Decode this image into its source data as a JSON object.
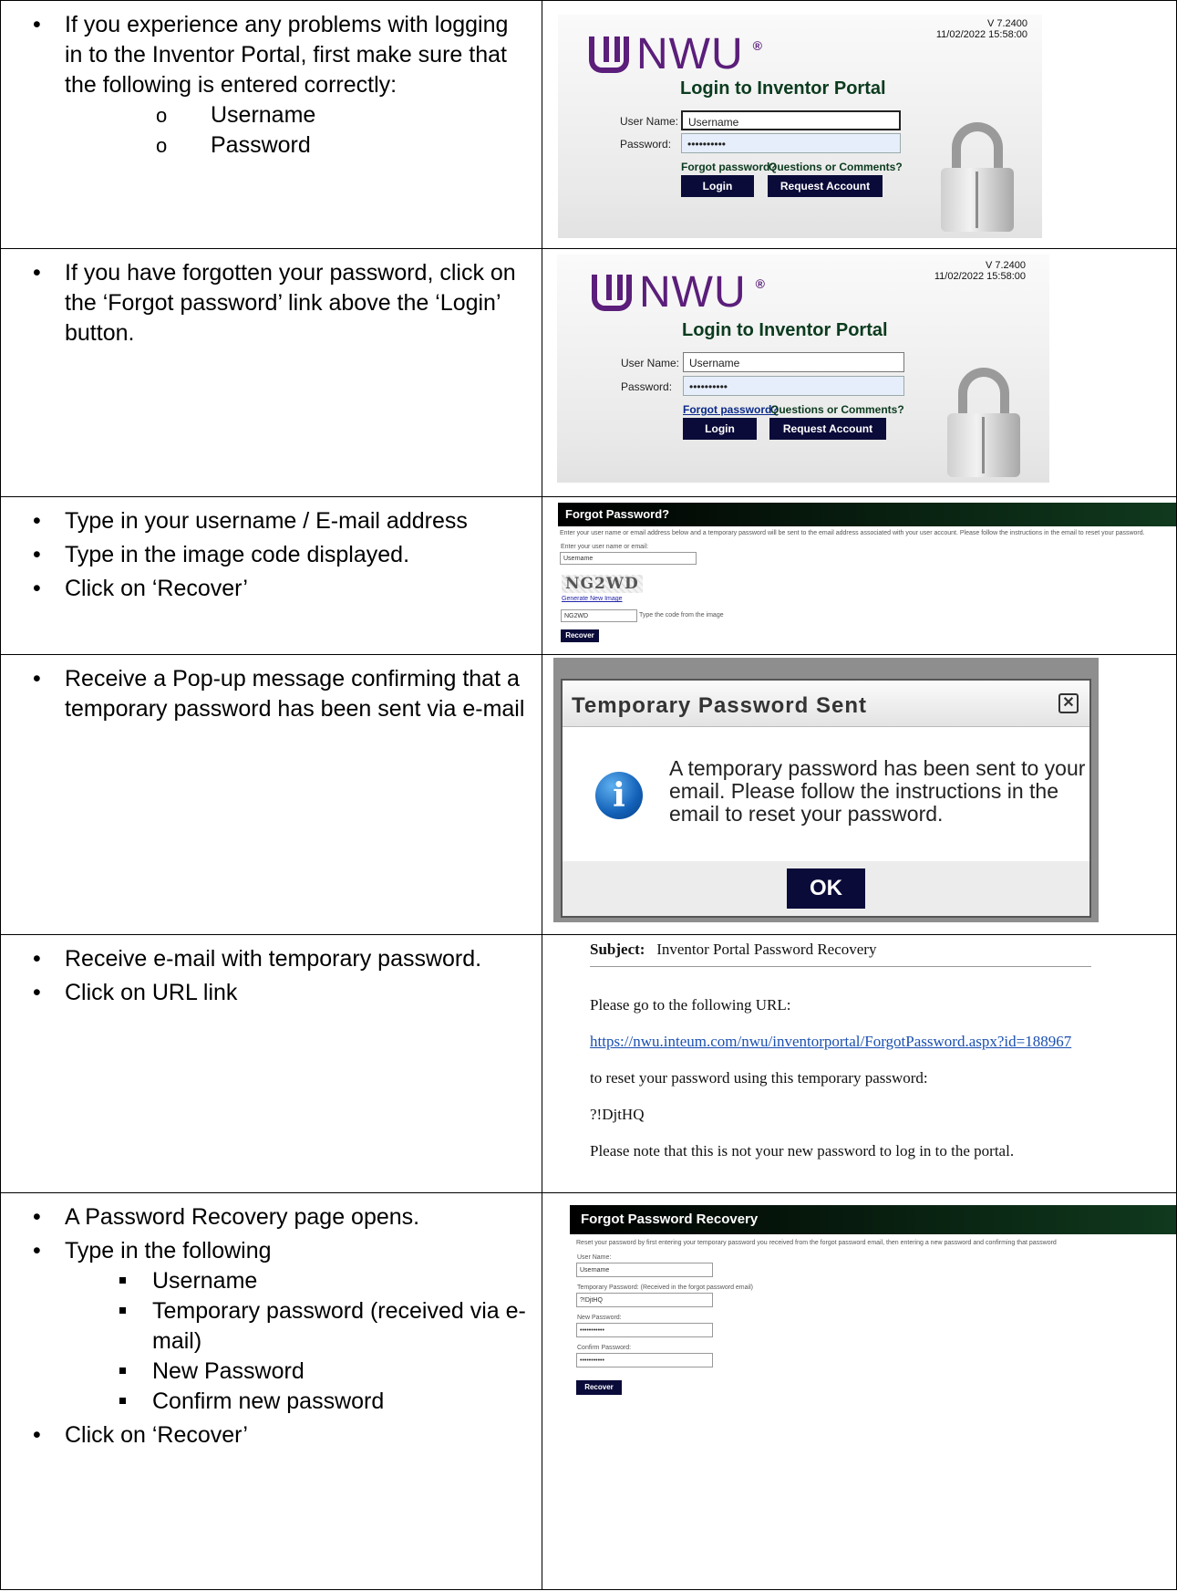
{
  "rows": [
    {
      "bullets": [
        "If you experience any problems with logging in to the Inventor Portal, first make sure that the following is entered correctly:"
      ],
      "sub_items": [
        "Username",
        "Password"
      ]
    },
    {
      "bullets": [
        "If you have forgotten your password, click on the ‘Forgot password’ link above the ‘Login’ button."
      ]
    },
    {
      "bullets": [
        "Type in your username / E-mail address",
        "Type in the image code displayed.",
        "Click on ‘Recover’"
      ]
    },
    {
      "bullets": [
        "Receive a Pop-up message confirming that a temporary password has been sent via e-mail"
      ]
    },
    {
      "bullets": [
        "Receive e-mail with temporary password.",
        "Click on URL link"
      ]
    },
    {
      "bullets": [
        "A Password Recovery page opens.",
        "Type in the following"
      ],
      "sub_items": [
        "Username",
        "Temporary password (received via e-mail)",
        "New Password",
        "Confirm new password"
      ],
      "last_bullet": "Click on ‘Recover’"
    }
  ],
  "login": {
    "brand": "NWU",
    "reg": "®",
    "version": "V 7.2400",
    "datetime": "11/02/2022 15:58:00",
    "title": "Login to Inventor Portal",
    "username_label": "User Name:",
    "password_label": "Password:",
    "username_value": "Username",
    "password_value": "••••••••••",
    "forgot_link": "Forgot password?",
    "questions_link": "Questions or Comments?",
    "login_button": "Login",
    "request_button": "Request Account"
  },
  "forgot": {
    "title": "Forgot Password?",
    "intro": "Enter your user name or email address below and a temporary password will be sent to the email address associated with your user account. Please follow the instructions in the email to reset your password.",
    "field_label": "Enter your user name or email:",
    "field_value": "Username",
    "captcha": "NG2WD",
    "new_image_link": "Generate New Image",
    "code_value": "NG2WD",
    "code_hint": "Type the code from the image",
    "recover_button": "Recover"
  },
  "popup": {
    "title": "Temporary Password Sent",
    "close_icon": "close-icon",
    "message_1": "A temporary password has been sent to your",
    "message_2": "email. Please follow the instructions in the",
    "message_3": "email to reset your password.",
    "ok_button": "OK"
  },
  "email": {
    "subject_label": "Subject:",
    "subject": "Inventor Portal Password Recovery",
    "line1": "Please go to the following URL:",
    "url": "https://nwu.inteum.com/nwu/inventorportal/ForgotPassword.aspx?id=188967",
    "line2": "to reset your password using this temporary password:",
    "temp_password": "?!DjtHQ",
    "line3": "Please note that this is not your new password to log in to the portal."
  },
  "recovery": {
    "title": "Forgot Password Recovery",
    "intro": "Reset your password by first entering your temporary password you received from the forgot password email, then entering a new password and confirming that password",
    "user_label": "User Name:",
    "user_value": "Username",
    "temp_label": "Temporary Password: (Received in the forgot password email)",
    "temp_value": "?!DjtHQ",
    "new_label": "New Password:",
    "new_value": "•••••••••••",
    "confirm_label": "Confirm Password:",
    "confirm_value": "•••••••••••",
    "recover_button": "Recover"
  }
}
